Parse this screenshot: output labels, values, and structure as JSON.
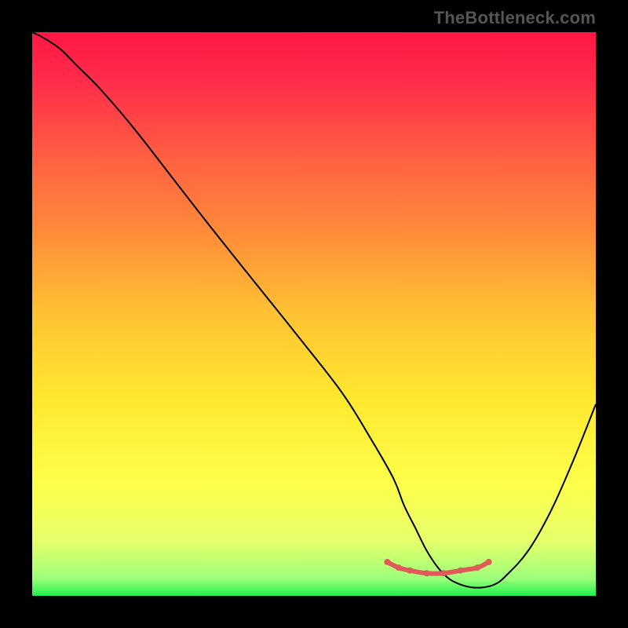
{
  "watermark": "TheBottleneck.com",
  "chart_data": {
    "type": "line",
    "title": "",
    "xlabel": "",
    "ylabel": "",
    "xlim": [
      0,
      100
    ],
    "ylim": [
      0,
      100
    ],
    "grid": false,
    "legend": false,
    "background_gradient": {
      "type": "vertical",
      "stops": [
        {
          "offset": 0.0,
          "color": "#ff1744"
        },
        {
          "offset": 0.08,
          "color": "#ff2a4a"
        },
        {
          "offset": 0.2,
          "color": "#ff5743"
        },
        {
          "offset": 0.35,
          "color": "#ff8a3a"
        },
        {
          "offset": 0.5,
          "color": "#ffc233"
        },
        {
          "offset": 0.65,
          "color": "#ffe82f"
        },
        {
          "offset": 0.8,
          "color": "#fdff4a"
        },
        {
          "offset": 0.9,
          "color": "#e8ff6a"
        },
        {
          "offset": 0.97,
          "color": "#9cff7a"
        },
        {
          "offset": 1.0,
          "color": "#1fef4d"
        }
      ]
    },
    "series": [
      {
        "name": "curve",
        "color": "#000000",
        "width": 2,
        "x": [
          0,
          2,
          5,
          8,
          12,
          18,
          25,
          32,
          40,
          48,
          55,
          60,
          64,
          66,
          68,
          70,
          72,
          74,
          76,
          78,
          80,
          82,
          84,
          88,
          92,
          96,
          100
        ],
        "y": [
          100,
          99,
          97,
          94,
          90,
          83,
          74,
          65,
          55,
          45,
          36,
          28,
          21,
          16,
          12,
          8,
          5,
          3,
          2,
          1.5,
          1.5,
          2,
          3.5,
          8,
          15,
          24,
          34
        ]
      },
      {
        "name": "bottom-marker",
        "type": "marker-run",
        "color": "#e05a5a",
        "radius": 4,
        "x": [
          63,
          65,
          67,
          70,
          73,
          76,
          79,
          81
        ],
        "y": [
          6,
          5,
          4.5,
          4,
          4,
          4.5,
          5,
          6
        ]
      }
    ]
  }
}
